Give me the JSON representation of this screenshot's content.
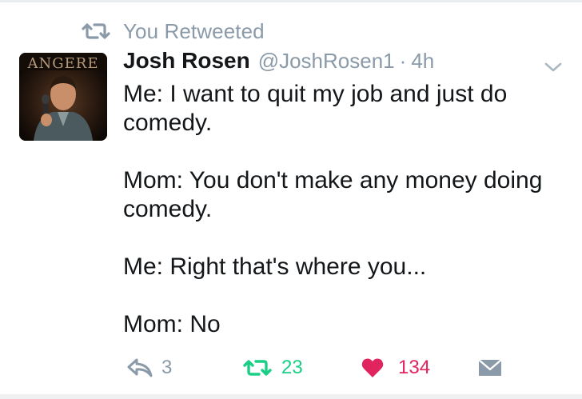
{
  "context": {
    "text": "You Retweeted",
    "icon": "retweet-icon"
  },
  "author": {
    "name": "Josh Rosen",
    "handle": "@JoshRosen1",
    "separator": "·",
    "time": "4h",
    "avatar_sign_text": "ANGERE"
  },
  "tweet": {
    "paragraphs": [
      "Me: I want to quit my job and just do comedy.",
      "Mom: You don't make any money doing comedy.",
      "Me: Right that's where you...",
      "Mom: No"
    ]
  },
  "actions": {
    "reply": {
      "icon": "reply-icon",
      "count": "3"
    },
    "retweet": {
      "icon": "retweet-icon",
      "count": "23",
      "active": true
    },
    "like": {
      "icon": "heart-icon",
      "count": "134",
      "active": true
    },
    "dm": {
      "icon": "envelope-icon"
    }
  },
  "colors": {
    "muted": "#8a9aa8",
    "retweet_active": "#19cf86",
    "like_active": "#e0245e",
    "text": "#14171a"
  }
}
